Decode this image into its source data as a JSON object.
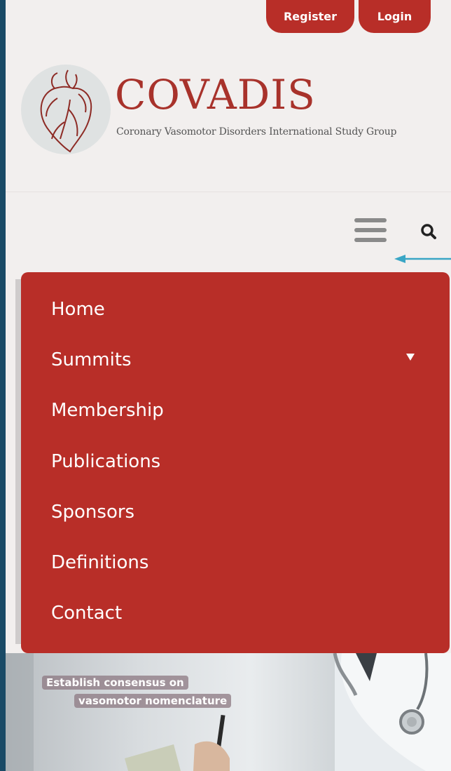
{
  "header": {
    "register_label": "Register",
    "login_label": "Login",
    "brand_name": "COVADIS",
    "tagline": "Coronary Vasomotor Disorders International Study Group"
  },
  "icons": {
    "menu": "hamburger-icon",
    "search": "search-icon",
    "caret": "caret-down-icon",
    "arrow": "arrow-left-icon"
  },
  "menu": {
    "items": [
      {
        "label": "Home"
      },
      {
        "label": "Summits"
      },
      {
        "label": "Membership"
      },
      {
        "label": "Publications"
      },
      {
        "label": "Sponsors"
      },
      {
        "label": "Definitions"
      },
      {
        "label": "Contact"
      }
    ]
  },
  "hero": {
    "line1": "Establish consensus on",
    "line2": "vasomotor nomenclature"
  },
  "colors": {
    "brand_red": "#b82e28",
    "frame_blue": "#1a4a66",
    "arrow_teal": "#3aa6c5"
  }
}
